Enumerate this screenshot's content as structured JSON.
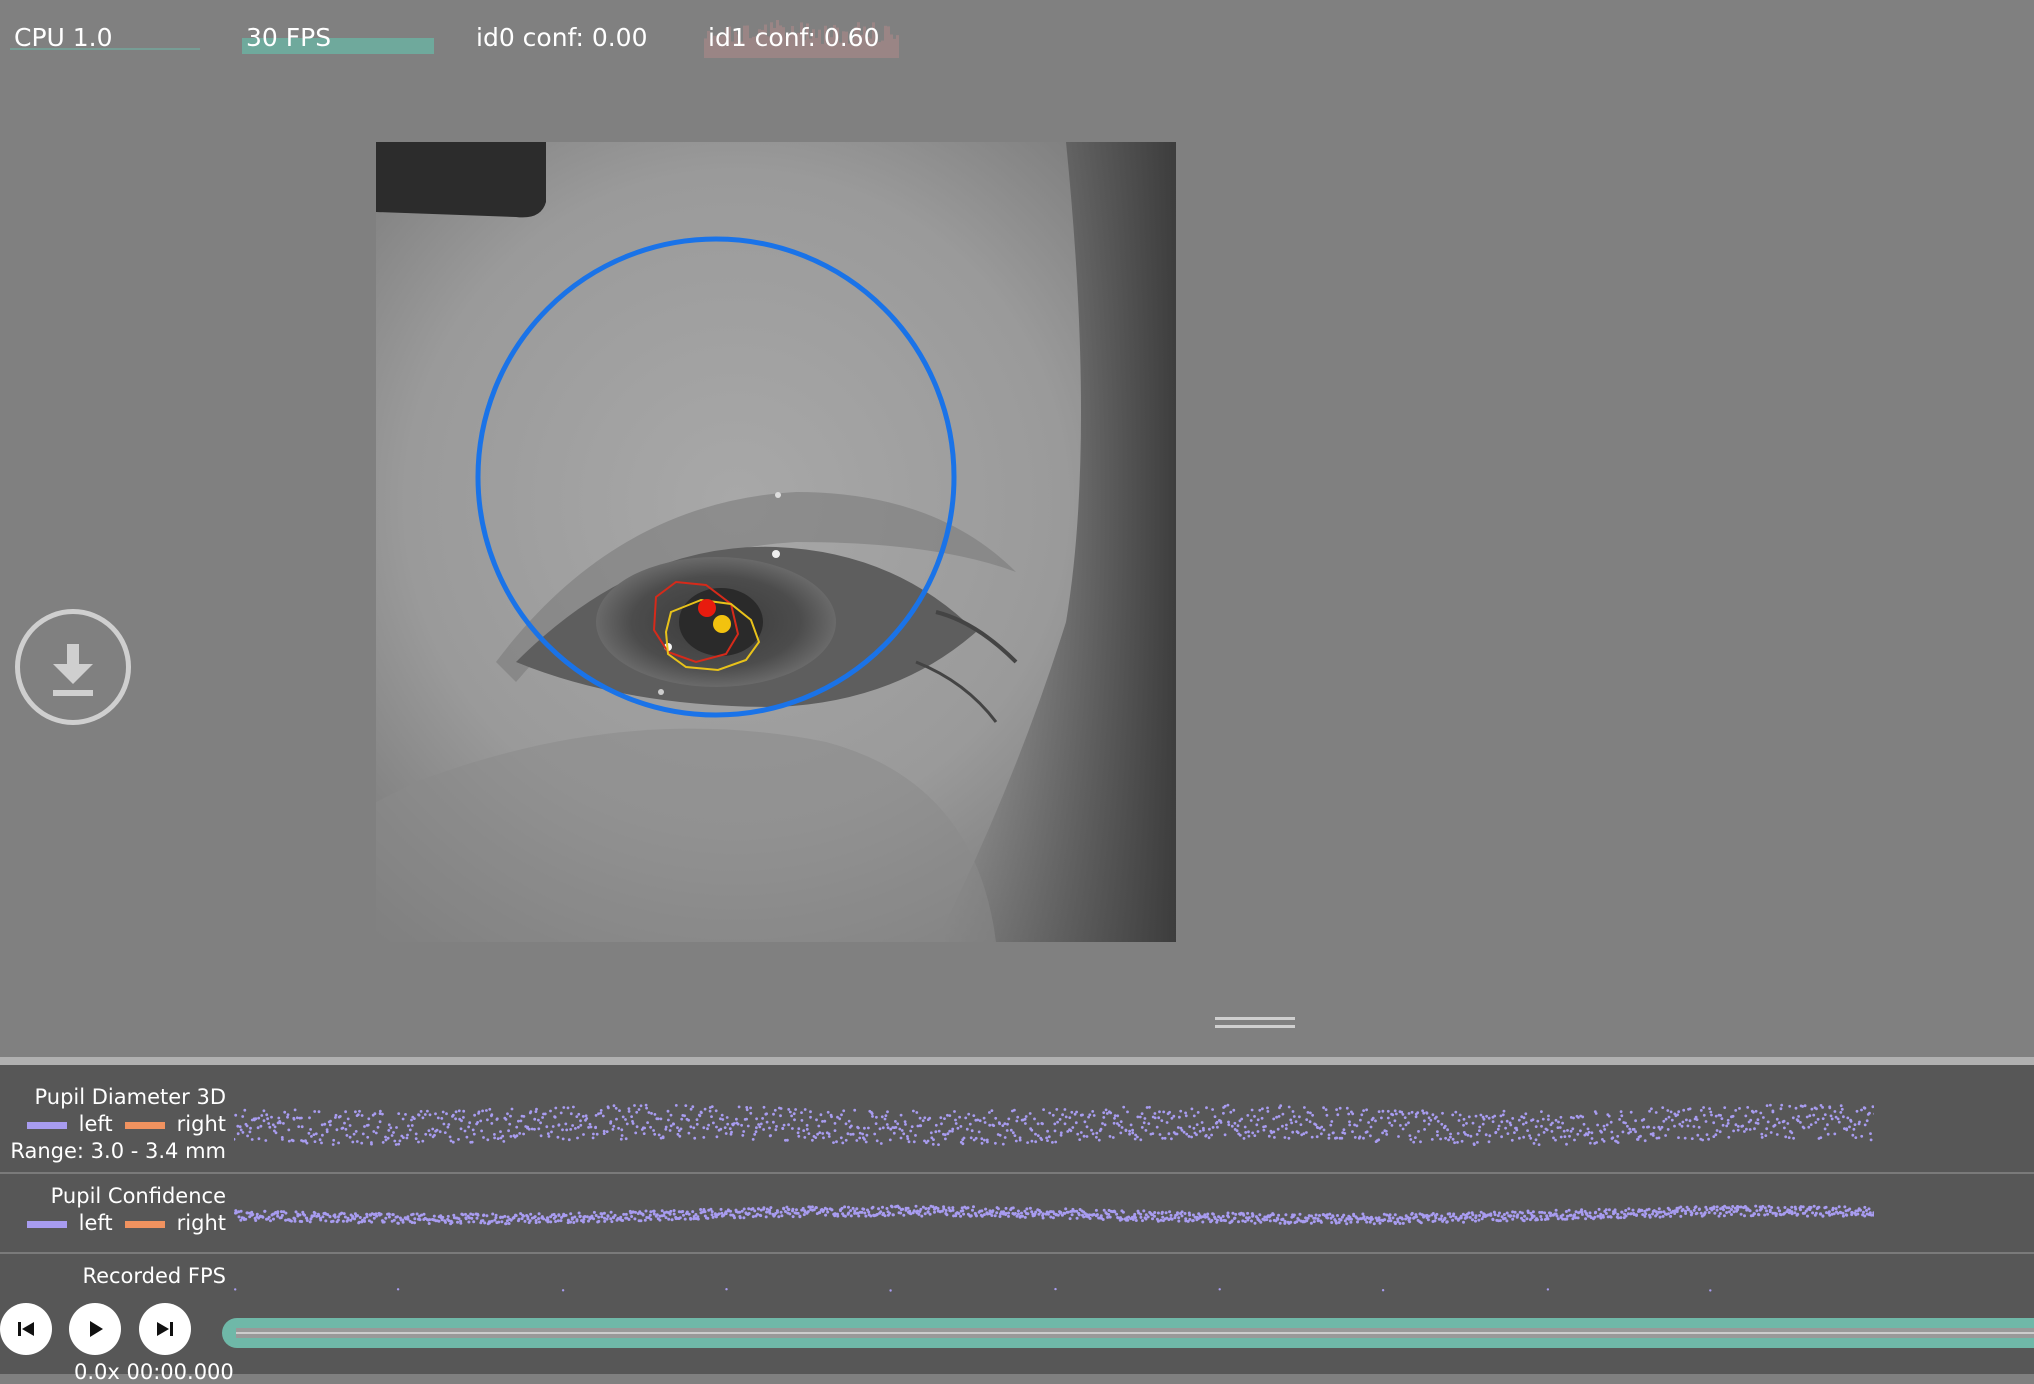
{
  "stats": {
    "cpu": "CPU 1.0",
    "fps": "30 FPS",
    "id0": "id0 conf: 0.00",
    "id1": "id1 conf: 0.60",
    "fps_fill_fraction": 1.0
  },
  "video": {
    "overlay_colors": {
      "eyeball_circle": "#1a73e8",
      "pupil_ellipse_2d": "#d62a1a",
      "pupil_center_2d": "#e81b0e",
      "pupil_ellipse_3d": "#e8c21a",
      "pupil_center_3d": "#f2c20f"
    }
  },
  "download": {
    "icon": "download-icon"
  },
  "timelines": {
    "pupil_diameter": {
      "title": "Pupil Diameter 3D",
      "left_label": "left",
      "right_label": "right",
      "range": "Range: 3.0 - 3.4 mm"
    },
    "pupil_confidence": {
      "title": "Pupil Confidence",
      "left_label": "left",
      "right_label": "right"
    },
    "recorded_fps": {
      "title": "Recorded FPS"
    },
    "colors": {
      "left": "#a89cf0",
      "right": "#f0925f",
      "points": "#a89cf0"
    }
  },
  "playback": {
    "prev_icon": "skip-previous-icon",
    "play_icon": "play-icon",
    "next_icon": "skip-next-icon",
    "time": "0.0x 00:00.000",
    "progress": 0.0
  },
  "colors": {
    "background": "#808080",
    "timeline_bg": "#575757",
    "accent": "#6fb8a8"
  }
}
